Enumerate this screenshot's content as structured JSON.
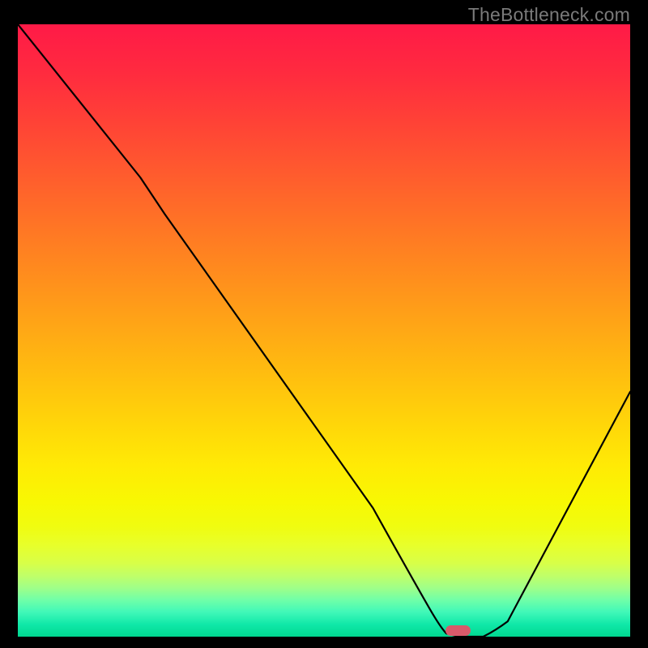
{
  "watermark": "TheBottleneck.com",
  "chart_data": {
    "type": "line",
    "title": "",
    "xlabel": "",
    "ylabel": "",
    "xlim": [
      0,
      100
    ],
    "ylim": [
      0,
      100
    ],
    "grid": false,
    "legend": false,
    "background": "red-yellow-green vertical gradient (red top, green bottom)",
    "series": [
      {
        "name": "bottleneck-curve",
        "type": "line",
        "color": "#000000",
        "x": [
          0,
          12,
          20,
          28,
          36,
          44,
          52,
          58,
          63,
          67,
          70,
          72,
          76,
          80,
          84,
          88,
          92,
          96,
          100
        ],
        "values": [
          100,
          86,
          75,
          64,
          53,
          42,
          31,
          21,
          12,
          5,
          1,
          0,
          0,
          2,
          8,
          15,
          23,
          31,
          40
        ]
      }
    ],
    "annotations": [
      {
        "name": "optimal-marker",
        "shape": "rounded-rect",
        "color": "#d85a6a",
        "x": 72,
        "y": 0,
        "width_pct": 4,
        "height_pct": 1.7
      }
    ]
  }
}
